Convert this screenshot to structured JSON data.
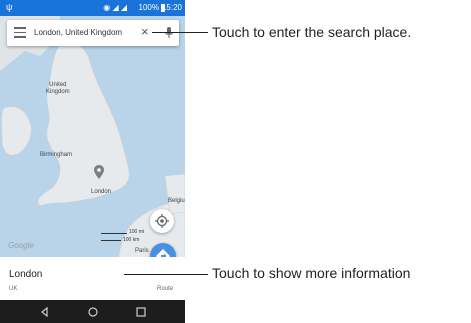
{
  "status_bar": {
    "time": "15:20",
    "battery": "100%",
    "icons": [
      "usb-icon",
      "location-icon",
      "wifi-icon",
      "signal-icon",
      "battery-icon"
    ]
  },
  "search": {
    "query": "London, United Kingdom",
    "icons": [
      "menu-icon",
      "close-icon",
      "mic-icon"
    ]
  },
  "map": {
    "labels": {
      "country": "United\nKingdom",
      "birmingham": "Birmingham",
      "london": "London",
      "paris": "Paris",
      "belgium": "Belgiu"
    },
    "scale": {
      "top": "100 mi",
      "bottom": "100 km"
    },
    "attribution": "Google",
    "buttons": [
      "my-location-icon",
      "directions-icon"
    ]
  },
  "info_panel": {
    "title": "London",
    "subtitle": "UK",
    "route_label": "Route"
  },
  "nav_bar": {
    "icons": [
      "back-icon",
      "home-icon",
      "recents-icon"
    ]
  },
  "callouts": {
    "search": "Touch to enter the search place.",
    "info": "Touch to show more information"
  },
  "colors": {
    "status_bar": "#1a73d9",
    "land": "#e8ecef",
    "sea": "#b9d3e8",
    "directions_fab": "#4a8fe0",
    "nav_bar": "#1d1d1d"
  }
}
